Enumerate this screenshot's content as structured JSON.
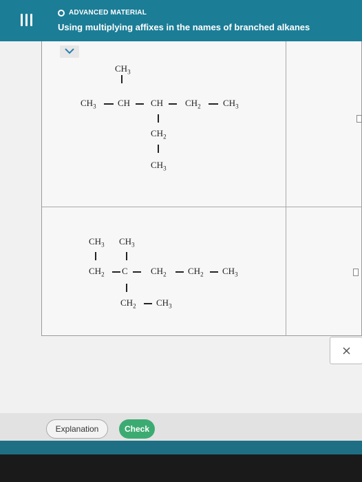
{
  "header": {
    "topic": "ADVANCED MATERIAL",
    "title": "Using multiplying affixes in the names of branched alkanes"
  },
  "molecule1": {
    "top_substituent": "CH3",
    "main_chain": [
      "CH3",
      "CH",
      "CH",
      "CH2",
      "CH3"
    ],
    "branch": [
      "CH2",
      "CH3"
    ]
  },
  "molecule2": {
    "top_substituents": [
      "CH3",
      "CH3"
    ],
    "main_chain": [
      "CH2",
      "C",
      "CH2",
      "CH2",
      "CH3"
    ],
    "branch": [
      "CH2",
      "CH3"
    ]
  },
  "buttons": {
    "explanation": "Explanation",
    "check": "Check",
    "close": "×"
  },
  "icons": {
    "menu": "menu-icon",
    "chevron": "chevron-down-icon",
    "close": "close-icon"
  }
}
